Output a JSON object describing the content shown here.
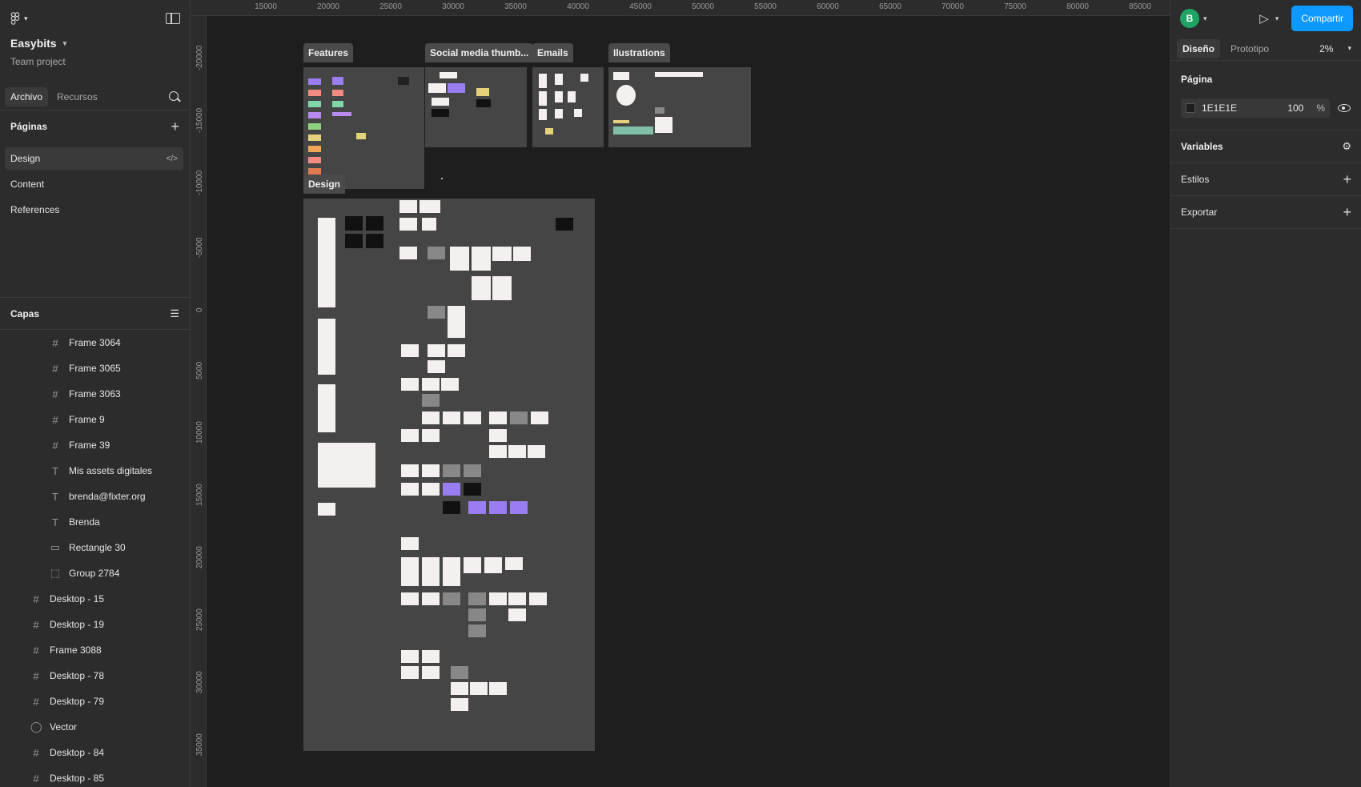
{
  "project": {
    "name": "Easybits",
    "subtitle": "Team project"
  },
  "left_tabs": {
    "file": "Archivo",
    "assets": "Recursos"
  },
  "pages": {
    "title": "Páginas",
    "items": [
      {
        "label": "Design",
        "active": true
      },
      {
        "label": "Content",
        "active": false
      },
      {
        "label": "References",
        "active": false
      }
    ]
  },
  "layers": {
    "title": "Capas",
    "items": [
      {
        "label": "Frame 3064",
        "icon": "frame-icon",
        "level": 2
      },
      {
        "label": "Frame 3065",
        "icon": "frame-icon",
        "level": 2
      },
      {
        "label": "Frame 3063",
        "icon": "frame-icon",
        "level": 2
      },
      {
        "label": "Frame 9",
        "icon": "frame-icon",
        "level": 2
      },
      {
        "label": "Frame 39",
        "icon": "frame-icon",
        "level": 2
      },
      {
        "label": "Mis assets digitales",
        "icon": "text-icon",
        "level": 2
      },
      {
        "label": "brenda@fixter.org",
        "icon": "text-icon",
        "level": 2
      },
      {
        "label": "Brenda",
        "icon": "text-icon",
        "level": 2
      },
      {
        "label": "Rectangle 30",
        "icon": "rectangle-icon",
        "level": 2
      },
      {
        "label": "Group 2784",
        "icon": "group-icon",
        "level": 2
      },
      {
        "label": "Desktop - 15",
        "icon": "frame-icon",
        "level": 1
      },
      {
        "label": "Desktop - 19",
        "icon": "frame-icon",
        "level": 1
      },
      {
        "label": "Frame 3088",
        "icon": "frame-icon",
        "level": 1
      },
      {
        "label": "Desktop - 78",
        "icon": "frame-icon",
        "level": 1
      },
      {
        "label": "Desktop - 79",
        "icon": "frame-icon",
        "level": 1
      },
      {
        "label": "Vector",
        "icon": "vector-icon",
        "level": 1
      },
      {
        "label": "Desktop - 84",
        "icon": "frame-icon",
        "level": 1
      },
      {
        "label": "Desktop - 85",
        "icon": "frame-icon",
        "level": 1
      }
    ]
  },
  "ruler": {
    "top": [
      "15000",
      "20000",
      "25000",
      "30000",
      "35000",
      "40000",
      "45000",
      "50000",
      "55000",
      "60000",
      "65000",
      "70000",
      "75000",
      "80000",
      "85000"
    ],
    "left": [
      "-20000",
      "-15000",
      "-10000",
      "-5000",
      "0",
      "5000",
      "10000",
      "15000",
      "20000",
      "25000",
      "30000",
      "35000"
    ]
  },
  "canvas_frames": {
    "features": "Features",
    "social": "Social media thumb...",
    "emails": "Emails",
    "illustrations": "Ilustrations",
    "design": "Design"
  },
  "right": {
    "avatar": "B",
    "share": "Compartir",
    "tab_design": "Diseño",
    "tab_prototype": "Prototipo",
    "zoom": "2%",
    "page_title": "Página",
    "page_fill_hex": "1E1E1E",
    "page_fill_opacity": "100",
    "percent": "%",
    "variables": "Variables",
    "styles": "Estilos",
    "export": "Exportar"
  },
  "colors": {
    "canvas_bg": "#1e1e1e",
    "panel_bg": "#2c2c2c",
    "accent": "#0d99ff",
    "avatar_bg": "#1fa463"
  }
}
